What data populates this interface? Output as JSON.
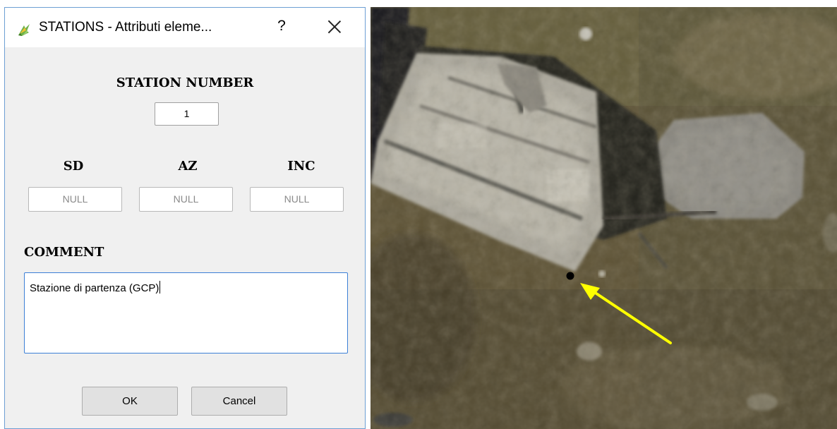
{
  "dialog": {
    "title": "STATIONS - Attributi eleme...",
    "help_label": "?",
    "app_icon": "qgis-icon",
    "station_number_label": "STATION NUMBER",
    "station_number_value": "1",
    "sd_label": "SD",
    "az_label": "AZ",
    "inc_label": "INC",
    "sd_value": "NULL",
    "az_value": "NULL",
    "inc_value": "NULL",
    "comment_label": "COMMENT",
    "comment_value": "Stazione di partenza (GCP)",
    "ok_label": "OK",
    "cancel_label": "Cancel"
  },
  "map": {
    "pointer_color": "#ffff00",
    "point_marker_color": "#000000"
  }
}
